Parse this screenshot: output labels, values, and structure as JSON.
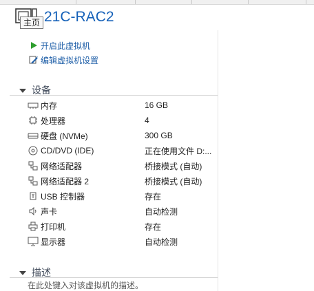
{
  "header": {
    "title": "21C-RAC2",
    "tooltip": "主页"
  },
  "actions": [
    {
      "label": "开启此虚拟机",
      "icon": "play-icon"
    },
    {
      "label": "编辑虚拟机设置",
      "icon": "edit-settings-icon"
    }
  ],
  "devices_section": {
    "title": "设备",
    "items": [
      {
        "name": "内存",
        "value": "16 GB",
        "icon": "memory-icon"
      },
      {
        "name": "处理器",
        "value": "4",
        "icon": "cpu-icon"
      },
      {
        "name": "硬盘 (NVMe)",
        "value": "300 GB",
        "icon": "hard-disk-icon"
      },
      {
        "name": "CD/DVD (IDE)",
        "value": "正在使用文件 D:...",
        "icon": "cd-dvd-icon"
      },
      {
        "name": "网络适配器",
        "value": "桥接模式 (自动)",
        "icon": "network-icon"
      },
      {
        "name": "网络适配器 2",
        "value": "桥接模式 (自动)",
        "icon": "network-icon"
      },
      {
        "name": "USB 控制器",
        "value": "存在",
        "icon": "usb-icon"
      },
      {
        "name": "声卡",
        "value": "自动检测",
        "icon": "speaker-icon"
      },
      {
        "name": "打印机",
        "value": "存在",
        "icon": "printer-icon"
      },
      {
        "name": "显示器",
        "value": "自动检测",
        "icon": "monitor-icon"
      }
    ]
  },
  "description_section": {
    "title": "描述",
    "placeholder": "在此处键入对该虚拟机的描述。"
  },
  "colors": {
    "title": "#1460b8",
    "link": "#1f5fa8",
    "play": "#2e9e2e"
  }
}
